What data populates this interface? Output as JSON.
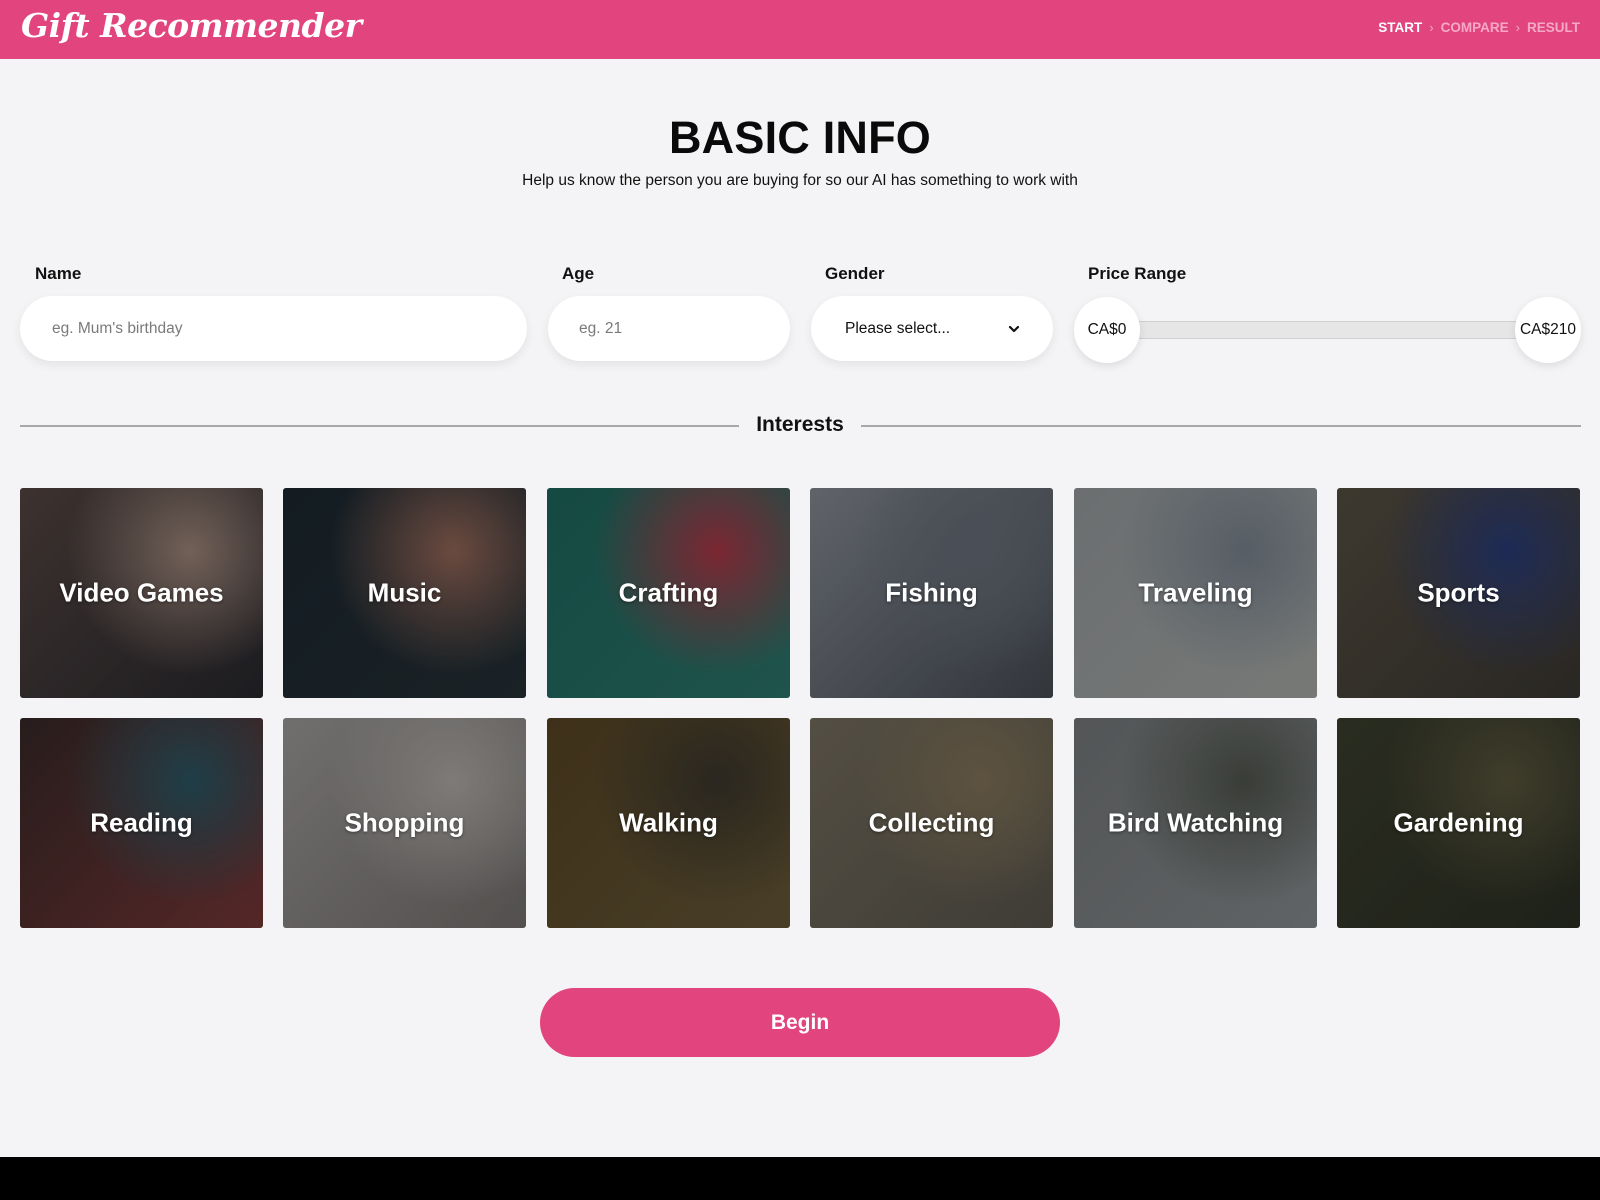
{
  "header": {
    "logo": "Gift Recommender",
    "steps": [
      {
        "label": "START",
        "active": true
      },
      {
        "label": "COMPARE",
        "active": false
      },
      {
        "label": "RESULT",
        "active": false
      }
    ],
    "separator": "›"
  },
  "page": {
    "title": "BASIC INFO",
    "subtitle": "Help us know the person you are buying for so our AI has something to work with"
  },
  "form": {
    "name": {
      "label": "Name",
      "placeholder": "eg. Mum's birthday",
      "value": ""
    },
    "age": {
      "label": "Age",
      "placeholder": "eg. 21",
      "value": ""
    },
    "gender": {
      "label": "Gender",
      "selected": "Please select..."
    },
    "price_range": {
      "label": "Price Range",
      "min_label": "CA$0",
      "max_label": "CA$210",
      "min": 0,
      "max": 210,
      "currency": "CA$"
    }
  },
  "interests": {
    "heading": "Interests",
    "items": [
      {
        "label": "Video Games",
        "colors": [
          "#5a4a46",
          "#a88f82",
          "#2a2a30"
        ]
      },
      {
        "label": "Music",
        "colors": [
          "#1d2a33",
          "#9e6e5e",
          "#273338"
        ]
      },
      {
        "label": "Crafting",
        "colors": [
          "#1f6d63",
          "#b63a4a",
          "#2e7c70"
        ]
      },
      {
        "label": "Fishing",
        "colors": [
          "#8e949c",
          "#6d7480",
          "#4a5058"
        ]
      },
      {
        "label": "Traveling",
        "colors": [
          "#9ea3a6",
          "#7f8a96",
          "#b0b3b0"
        ]
      },
      {
        "label": "Sports",
        "colors": [
          "#5b5446",
          "#2c3f7e",
          "#3e3a35"
        ]
      },
      {
        "label": "Reading",
        "colors": [
          "#3a2b2a",
          "#2e5c6a",
          "#7e3a3a"
        ]
      },
      {
        "label": "Shopping",
        "colors": [
          "#a7a4a2",
          "#b9b5b1",
          "#7a7674"
        ]
      },
      {
        "label": "Walking",
        "colors": [
          "#5c4826",
          "#3e3a30",
          "#6b5c3a"
        ]
      },
      {
        "label": "Collecting",
        "colors": [
          "#7c7464",
          "#8a7a5e",
          "#5d5a50"
        ]
      },
      {
        "label": "Bird Watching",
        "colors": [
          "#7b7e80",
          "#555a52",
          "#8e9396"
        ]
      },
      {
        "label": "Gardening",
        "colors": [
          "#3e4230",
          "#5e5a40",
          "#2e3226"
        ]
      }
    ]
  },
  "actions": {
    "begin": "Begin"
  },
  "colors": {
    "brand": "#e2457d",
    "background": "#f4f4f6"
  }
}
